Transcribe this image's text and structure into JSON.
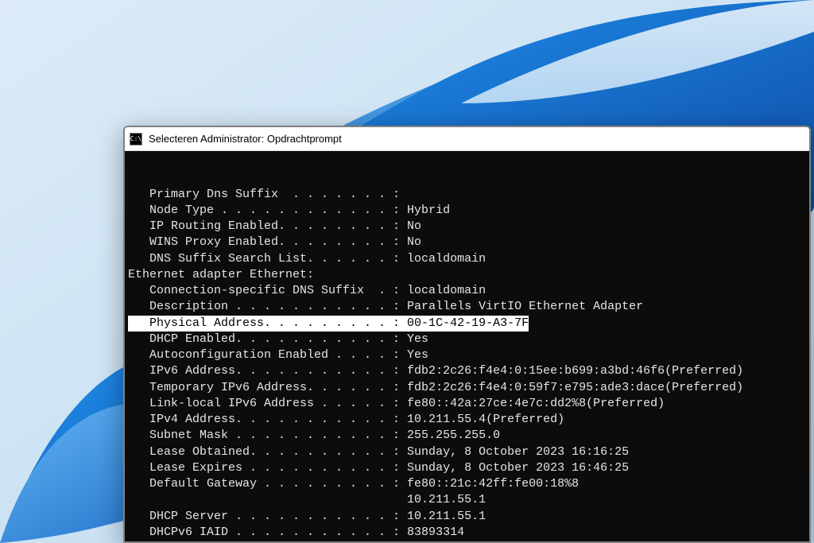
{
  "window": {
    "title": "Selecteren Administrator: Opdrachtprompt",
    "icon_glyph": "C:\\"
  },
  "terminal": {
    "header_lines": [
      "   Primary Dns Suffix  . . . . . . . :",
      "   Node Type . . . . . . . . . . . . : Hybrid",
      "   IP Routing Enabled. . . . . . . . : No",
      "   WINS Proxy Enabled. . . . . . . . : No",
      "   DNS Suffix Search List. . . . . . : localdomain"
    ],
    "adapter_title": "Ethernet adapter Ethernet:",
    "adapter_lines_pre": [
      "   Connection-specific DNS Suffix  . : localdomain",
      "   Description . . . . . . . . . . . : Parallels VirtIO Ethernet Adapter"
    ],
    "highlight_line": "   Physical Address. . . . . . . . . : 00-1C-42-19-A3-7F",
    "adapter_lines_post": [
      "   DHCP Enabled. . . . . . . . . . . : Yes",
      "   Autoconfiguration Enabled . . . . : Yes",
      "   IPv6 Address. . . . . . . . . . . : fdb2:2c26:f4e4:0:15ee:b699:a3bd:46f6(Preferred)",
      "   Temporary IPv6 Address. . . . . . : fdb2:2c26:f4e4:0:59f7:e795:ade3:dace(Preferred)",
      "   Link-local IPv6 Address . . . . . : fe80::42a:27ce:4e7c:dd2%8(Preferred)",
      "   IPv4 Address. . . . . . . . . . . : 10.211.55.4(Preferred)",
      "   Subnet Mask . . . . . . . . . . . : 255.255.255.0",
      "   Lease Obtained. . . . . . . . . . : Sunday, 8 October 2023 16:16:25",
      "   Lease Expires . . . . . . . . . . : Sunday, 8 October 2023 16:46:25",
      "   Default Gateway . . . . . . . . . : fe80::21c:42ff:fe00:18%8",
      "                                       10.211.55.1",
      "   DHCP Server . . . . . . . . . . . : 10.211.55.1",
      "   DHCPv6 IAID . . . . . . . . . . . : 83893314"
    ]
  }
}
